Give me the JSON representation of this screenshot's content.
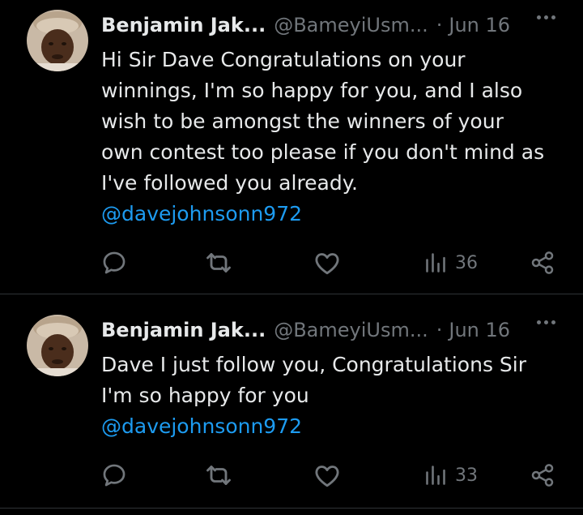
{
  "colors": {
    "background": "#000000",
    "text": "#e7e9ea",
    "secondary": "#71767b",
    "link": "#1d9bf0",
    "divider": "#2f3336"
  },
  "tweets": [
    {
      "name": "Benjamin Jak...",
      "handle": "@BameyiUsm...",
      "separator": "·",
      "date": "Jun 16",
      "lines": [
        "Hi Sir Dave Congratulations on your",
        "winnings, I'm so happy for you, and I also",
        "wish to be amongst the winners of your",
        "own contest too please if you don't mind as",
        "I've followed you already."
      ],
      "mention": "@davejohnsonn972",
      "views": "36",
      "icons": [
        "reply-icon",
        "retweet-icon",
        "like-icon",
        "views-icon",
        "share-icon",
        "more-icon"
      ]
    },
    {
      "name": "Benjamin Jak...",
      "handle": "@BameyiUsm...",
      "separator": "·",
      "date": "Jun 16",
      "lines": [
        "Dave I just follow you, Congratulations Sir",
        "I'm so happy for you"
      ],
      "mention": "@davejohnsonn972",
      "views": "33",
      "icons": [
        "reply-icon",
        "retweet-icon",
        "like-icon",
        "views-icon",
        "share-icon",
        "more-icon"
      ]
    }
  ]
}
